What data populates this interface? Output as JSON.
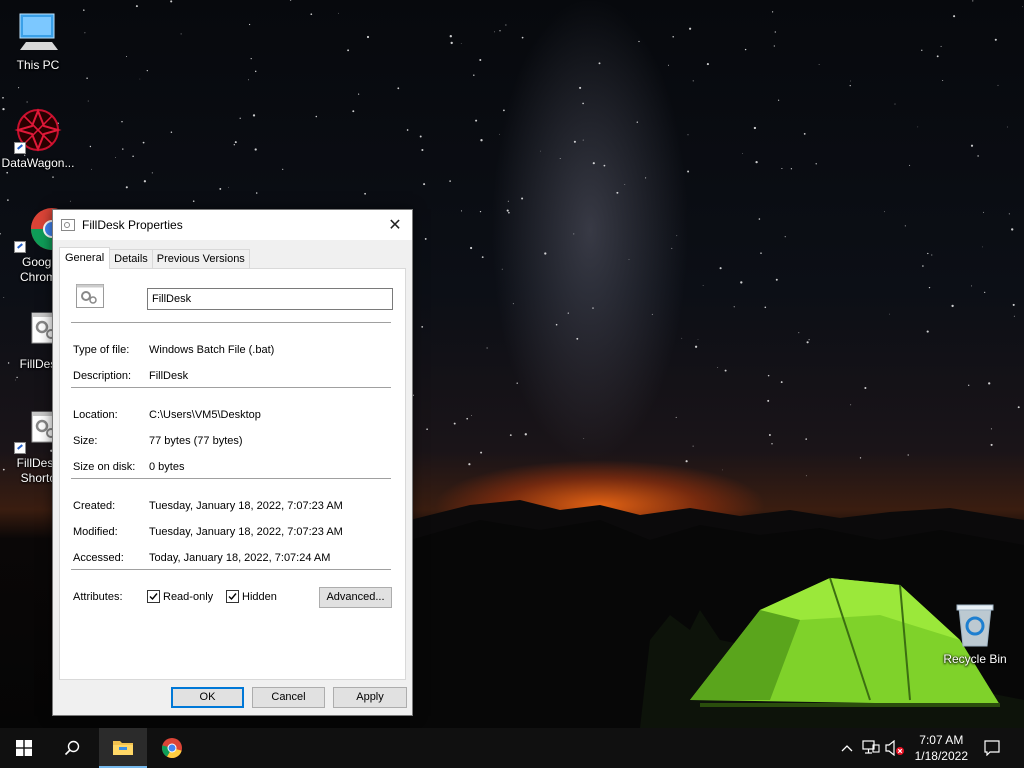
{
  "desktop": {
    "icons": [
      {
        "label": "This PC",
        "icon": "computer-icon"
      },
      {
        "label": "DataWagon...",
        "icon": "datawagon-icon"
      },
      {
        "label": "Googl",
        "label2": "Chrom",
        "icon": "chrome-icon"
      },
      {
        "label": "FillDes",
        "icon": "batch-file-icon"
      },
      {
        "label": "FillDesk",
        "label2": "Shortc",
        "icon": "batch-file-icon"
      },
      {
        "label": "Recycle Bin",
        "icon": "recycle-bin-icon"
      }
    ]
  },
  "dialog": {
    "title": "FillDesk Properties",
    "close_icon": "close-icon",
    "tabs": [
      {
        "label": "General",
        "active": true
      },
      {
        "label": "Details",
        "active": false
      },
      {
        "label": "Previous Versions",
        "active": false
      }
    ],
    "name_value": "FillDesk",
    "fields": {
      "type_label": "Type of file:",
      "type_value": "Windows Batch File (.bat)",
      "desc_label": "Description:",
      "desc_value": "FillDesk",
      "location_label": "Location:",
      "location_value": "C:\\Users\\VM5\\Desktop",
      "size_label": "Size:",
      "size_value": "77 bytes (77 bytes)",
      "disk_label": "Size on disk:",
      "disk_value": "0 bytes",
      "created_label": "Created:",
      "created_value": "Tuesday, January 18, 2022, 7:07:23 AM",
      "modified_label": "Modified:",
      "modified_value": "Tuesday, January 18, 2022, 7:07:23 AM",
      "accessed_label": "Accessed:",
      "accessed_value": "Today, January 18, 2022, 7:07:24 AM",
      "attributes_label": "Attributes:"
    },
    "attributes": {
      "readonly_label": "Read-only",
      "readonly_checked": true,
      "hidden_label": "Hidden",
      "hidden_checked": true,
      "advanced_label": "Advanced..."
    },
    "buttons": {
      "ok": "OK",
      "cancel": "Cancel",
      "apply": "Apply"
    }
  },
  "taskbar": {
    "start_icon": "windows-start-icon",
    "search_icon": "search-icon",
    "pinned": [
      "file-explorer-icon",
      "chrome-icon"
    ],
    "tray": [
      "chevron-up-icon",
      "network-icon",
      "volume-muted-icon",
      "notification-icon"
    ],
    "time": "7:07 AM",
    "date": "1/18/2022"
  },
  "colors": {
    "accent": "#0078d7",
    "taskbar": "#101010",
    "dialog_bg": "#f0f0f0"
  }
}
